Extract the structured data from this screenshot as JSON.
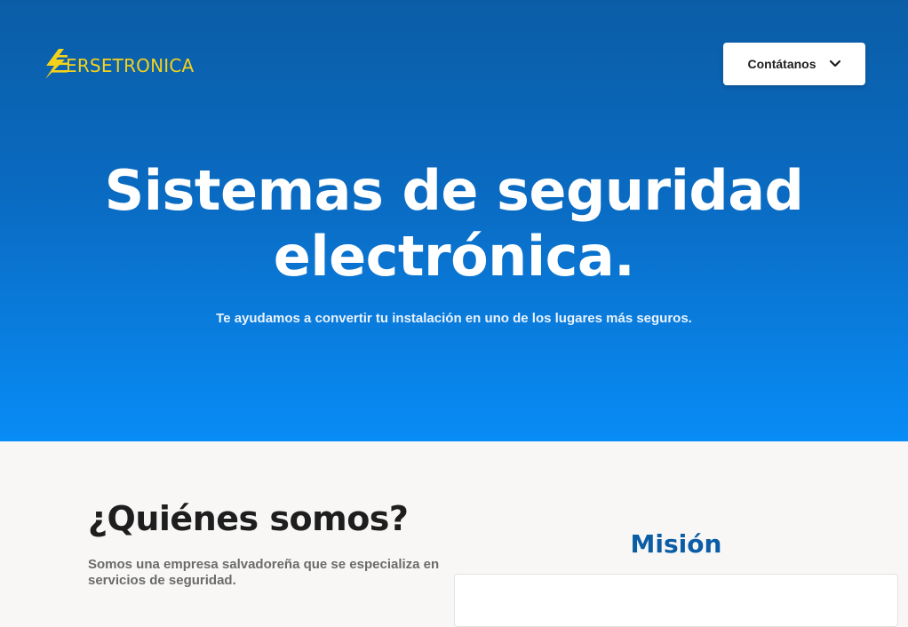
{
  "header": {
    "logo_text": "ERSETRONICA",
    "logo_icon": "lightning-bolt-icon",
    "contact_button_label": "Contátanos",
    "contact_button_icon": "chevron-down-icon"
  },
  "hero": {
    "title_line1": "Sistemas de seguridad",
    "title_line2": "electrónica.",
    "subtitle": "Te ayudamos a convertir tu instalación en uno de los lugares más seguros."
  },
  "about": {
    "title": "¿Quiénes somos?",
    "text": "Somos una empresa salvadoreña que se especializa en servicios de seguridad."
  },
  "mision": {
    "title": "Misión"
  },
  "colors": {
    "hero_top": "#0b5da6",
    "hero_bottom": "#088cf6",
    "logo": "#f5d21a",
    "mision_title": "#0b5da6",
    "section_bg": "#f8f7f6"
  }
}
